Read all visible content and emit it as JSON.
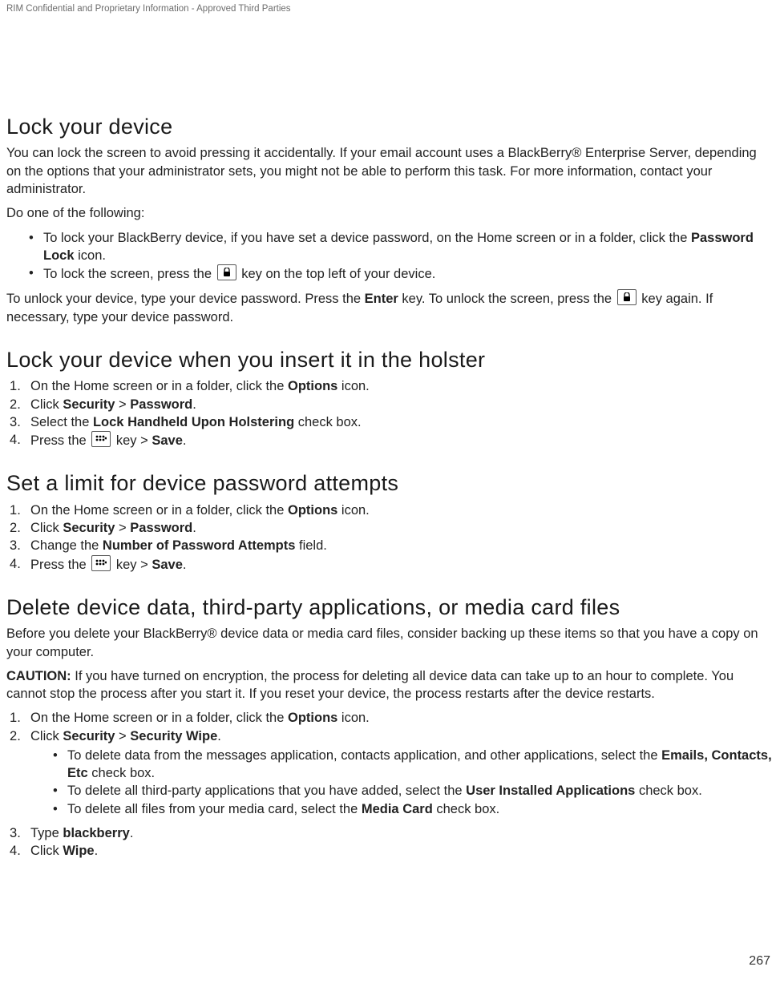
{
  "header_note": "RIM Confidential and Proprietary Information - Approved Third Parties",
  "page_number": "267",
  "s1": {
    "heading": "Lock your device",
    "p1": "You can lock the screen to avoid pressing it accidentally. If your email account uses a BlackBerry® Enterprise Server, depending on the options that your administrator sets, you might not be able to perform this task. For more information, contact your administrator.",
    "p2": "Do one of the following:",
    "b1_a": "To lock your BlackBerry device, if you have set a device password, on the Home screen or in a folder, click the ",
    "b1_bold": "Password Lock",
    "b1_b": " icon.",
    "b2_a": "To lock the screen, press the ",
    "b2_b": " key on the top left of your device.",
    "p3_a": "To unlock your device, type your device password. Press the ",
    "p3_bold": "Enter",
    "p3_b": " key. To unlock the screen, press the ",
    "p3_c": " key again. If necessary, type your device password."
  },
  "s2": {
    "heading": "Lock your device when you insert it in the holster",
    "i1_a": "On the Home screen or in a folder, click the ",
    "i1_bold": "Options",
    "i1_b": " icon.",
    "i2_a": "Click ",
    "i2_b1": "Security",
    "i2_sep": " > ",
    "i2_b2": "Password",
    "i2_end": ".",
    "i3_a": "Select the ",
    "i3_bold": "Lock Handheld Upon Holstering",
    "i3_b": " check box.",
    "i4_a": "Press the ",
    "i4_b": " key > ",
    "i4_bold": "Save",
    "i4_end": "."
  },
  "s3": {
    "heading": "Set a limit for device password attempts",
    "i1_a": "On the Home screen or in a folder, click the ",
    "i1_bold": "Options",
    "i1_b": " icon.",
    "i2_a": "Click ",
    "i2_b1": "Security",
    "i2_sep": " > ",
    "i2_b2": "Password",
    "i2_end": ".",
    "i3_a": "Change the ",
    "i3_bold": "Number of Password Attempts",
    "i3_b": " field.",
    "i4_a": "Press the ",
    "i4_b": " key > ",
    "i4_bold": "Save",
    "i4_end": "."
  },
  "s4": {
    "heading": "Delete device data, third-party applications, or media card files",
    "p1": "Before you delete your BlackBerry® device data or media card files, consider backing up these items so that you have a copy on your computer.",
    "caution_label": "CAUTION:",
    "caution_text": " If you have turned on encryption, the process for deleting all device data can take up to an hour to complete. You cannot stop the process after you start it. If you reset your device, the process restarts after the device restarts.",
    "i1_a": "On the Home screen or in a folder, click the ",
    "i1_bold": "Options",
    "i1_b": " icon.",
    "i2_a": "Click ",
    "i2_b1": "Security",
    "i2_sep": " > ",
    "i2_b2": "Security Wipe",
    "i2_end": ".",
    "sub1_a": "To delete data from the messages application, contacts application, and other applications, select the ",
    "sub1_bold": "Emails, Contacts, Etc",
    "sub1_b": " check box.",
    "sub2_a": "To delete all third-party applications that you have added, select the ",
    "sub2_bold": "User Installed Applications",
    "sub2_b": " check box.",
    "sub3_a": "To delete all files from your media card, select the ",
    "sub3_bold": "Media Card",
    "sub3_b": " check box.",
    "i3_a": "Type ",
    "i3_bold": "blackberry",
    "i3_end": ".",
    "i4_a": "Click ",
    "i4_bold": "Wipe",
    "i4_end": "."
  }
}
